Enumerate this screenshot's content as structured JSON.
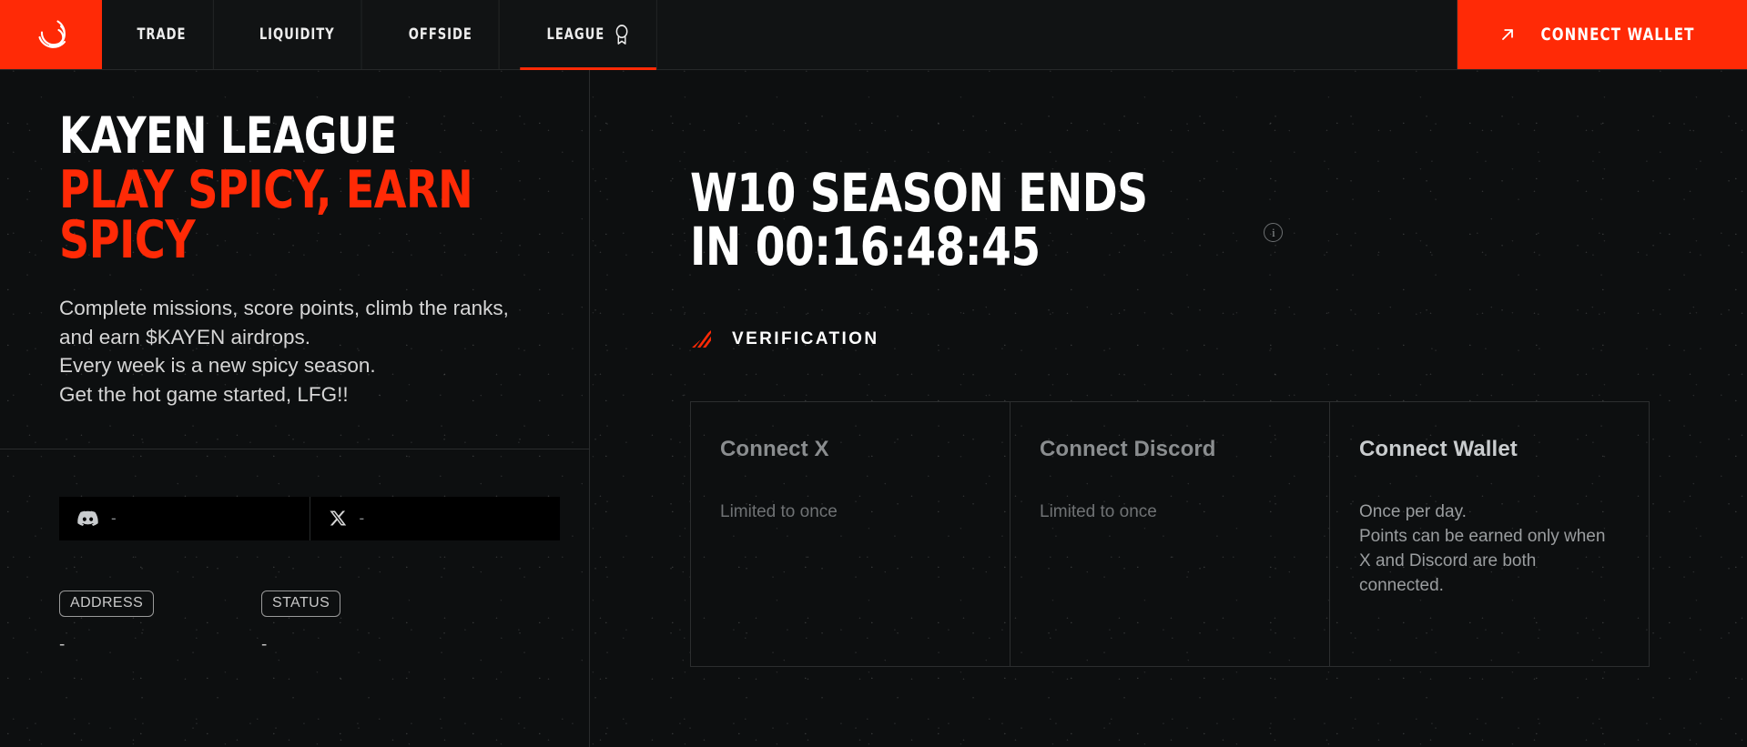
{
  "brand": {
    "logo_icon": "kayen-swirl-logo",
    "accent": "#FF2A06",
    "background": "#0d0f10"
  },
  "nav": {
    "items": [
      {
        "label": "TRADE",
        "active": false
      },
      {
        "label": "LIQUIDITY",
        "active": false
      },
      {
        "label": "OFFSIDE",
        "active": false
      },
      {
        "label": "LEAGUE",
        "active": true,
        "icon": "award-badge-icon"
      }
    ],
    "connect_wallet": {
      "label": "CONNECT WALLET",
      "icon": "arrow-up-right-icon"
    }
  },
  "hero": {
    "title": "KAYEN LEAGUE",
    "subtitle": "PLAY SPICY, EARN SPICY",
    "description": "Complete missions, score points, climb the ranks, and earn $KAYEN airdrops.\nEvery week is a new spicy season.\nGet the hot game started, LFG!!"
  },
  "socials": [
    {
      "icon": "discord-icon",
      "name": "discord",
      "value": "-"
    },
    {
      "icon": "x-twitter-icon",
      "name": "x",
      "value": "-"
    }
  ],
  "meta": [
    {
      "label": "ADDRESS",
      "value": "-"
    },
    {
      "label": "STATUS",
      "value": "-"
    }
  ],
  "season": {
    "line1": "W10 SEASON ENDS",
    "line2": "IN 00:16:48:45",
    "info_icon": "info-circle-icon"
  },
  "verification": {
    "icon": "striped-triangle-icon",
    "label": "VERIFICATION",
    "cards": [
      {
        "title": "Connect X",
        "description": "Limited to once",
        "bright": false
      },
      {
        "title": "Connect Discord",
        "description": "Limited to once",
        "bright": false
      },
      {
        "title": "Connect Wallet",
        "description": "Once per day.\nPoints can be earned only when X and Discord are both connected.",
        "bright": true
      }
    ]
  }
}
